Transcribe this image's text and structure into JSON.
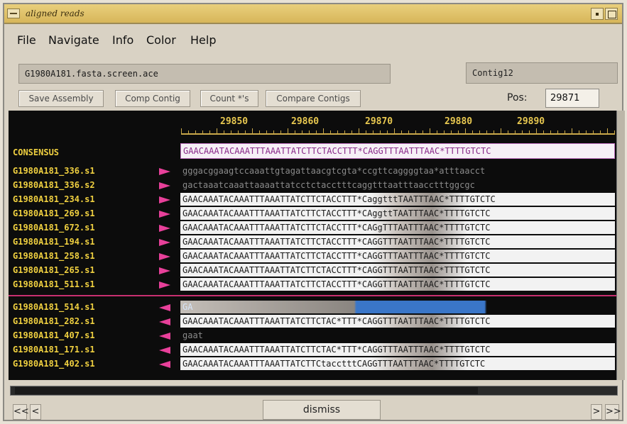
{
  "window": {
    "title": "aligned reads"
  },
  "menu": [
    "File",
    "Navigate",
    "Info",
    "Color",
    "Help"
  ],
  "file_field": "G1980A181.fasta.screen.ace",
  "contig_field": "Contig12",
  "toolbar": {
    "save_assembly": "Save Assembly",
    "comp_contig": "Comp Contig",
    "count_stars": "Count *'s",
    "compare_contigs": "Compare Contigs",
    "pos_label": "Pos:",
    "pos_value": "29871"
  },
  "ruler": [
    "29850",
    "29860",
    "29870",
    "29880",
    "29890"
  ],
  "consensus": {
    "label": "CONSENSUS",
    "sequence": "GAACAAATACAAATTTAAATTATCTTCTACCTTT*CAGGTTTAATTTAAC*TTTTGTCTC"
  },
  "reads_forward": [
    {
      "name": "G1980A181_336.s1",
      "sequence": "gggacggaagtccaaattgtagattaacgtcgta*ccgttcaggggtaa*atttaacct",
      "quality": "low"
    },
    {
      "name": "G1980A181_336.s2",
      "sequence": "gactaaatcaaattaaaattatcctctacctttcaggtttaatttaacctttggcgc",
      "quality": "low"
    },
    {
      "name": "G1980A181_234.s1",
      "sequence": "GAACAAATACAAATTTAAATTATCTTCTACCTTT*CaggtttTAATTTAAC*TTTTGTCTC",
      "quality": "full"
    },
    {
      "name": "G1980A181_269.s1",
      "sequence": "GAACAAATACAAATTTAAATTATCTTCTACCTTT*CAggttTAATTTAAC*TTTTGTCTC",
      "quality": "full"
    },
    {
      "name": "G1980A181_672.s1",
      "sequence": "GAACAAATACAAATTTAAATTATCTTCTACCTTT*CAGgTTTAATTTAAC*TTTTGTCTC",
      "quality": "full"
    },
    {
      "name": "G1980A181_194.s1",
      "sequence": "GAACAAATACAAATTTAAATTATCTTCTACCTTT*CAGGTTTAATTTAAC*TTTTGTCTC",
      "quality": "full"
    },
    {
      "name": "G1980A181_258.s1",
      "sequence": "GAACAAATACAAATTTAAATTATCTTCTACCTTT*CAGGTTTAATTTAAC*TTTTGTCTC",
      "quality": "full"
    },
    {
      "name": "G1980A181_265.s1",
      "sequence": "GAACAAATACAAATTTAAATTATCTTCTACCTTT*CAGGTTTAATTTAAC*TTTTGTCTC",
      "quality": "full"
    },
    {
      "name": "G1980A181_511.s1",
      "sequence": "GAACAAATACAAATTTAAATTATCTTCTACCTTT*CAGGTTTAATTTAAC*TTTTGTCTC",
      "quality": "full"
    }
  ],
  "reads_reverse": [
    {
      "name": "G1980A181_514.s1",
      "sequence": "GA",
      "quality": "partial"
    },
    {
      "name": "G1980A181_282.s1",
      "sequence": "GAACAAATACAAATTTAAATTATCTTCTAC*TTT*CAGGTTTAATTTAAC*TTTTGTCTC",
      "quality": "full"
    },
    {
      "name": "G1980A181_407.s1",
      "sequence": "gaat",
      "quality": "low"
    },
    {
      "name": "G1980A181_171.s1",
      "sequence": "GAACAAATACAAATTTAAATTATCTTCTAC*TTT*CAGGTTTAATTTAAC*TTTTGTCTC",
      "quality": "full"
    },
    {
      "name": "G1980A181_402.s1",
      "sequence": "GAACAAATACAAATTTAAATTATCTTCtacctttCAGGTTTAATTTAAC*TTTTGTCTC",
      "quality": "full"
    }
  ],
  "bottom": {
    "first": "<<",
    "prev": "<",
    "dismiss": "dismiss",
    "next": ">",
    "last": ">>"
  }
}
